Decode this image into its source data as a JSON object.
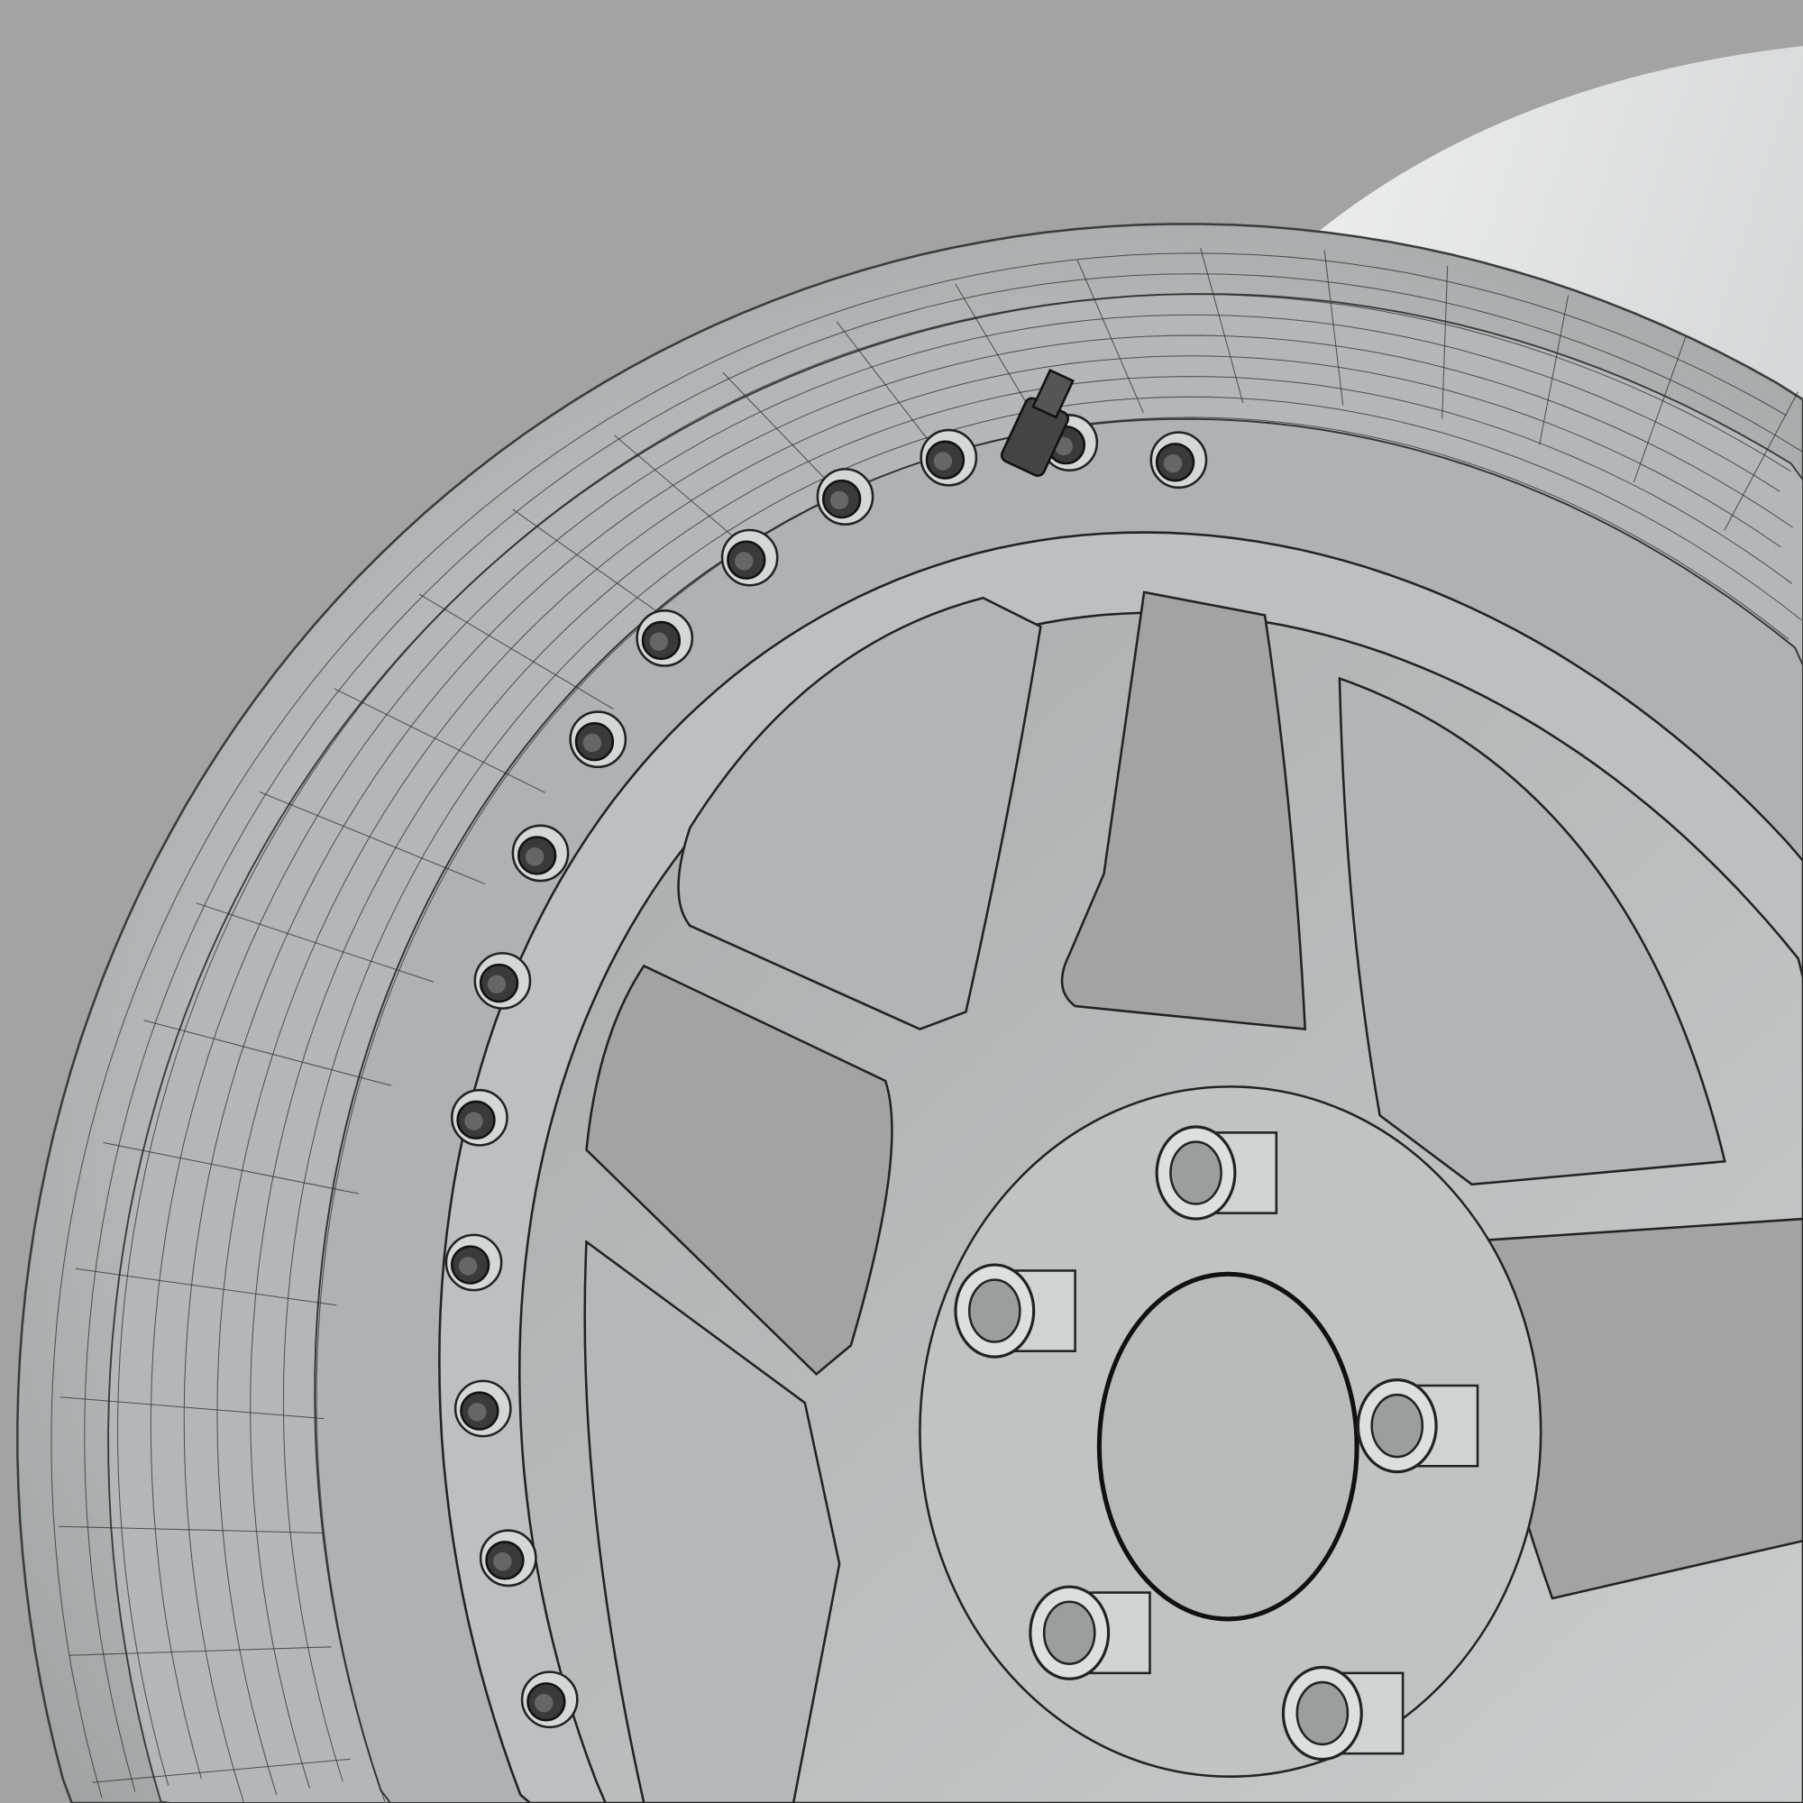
{
  "render": {
    "background": "#a3a3a3",
    "surface_light": "#dfe2e3",
    "surface_mid": "#b9bdbf",
    "surface_dark": "#8e9293",
    "wire": "#2a2c2c",
    "bolt": "#222222"
  }
}
